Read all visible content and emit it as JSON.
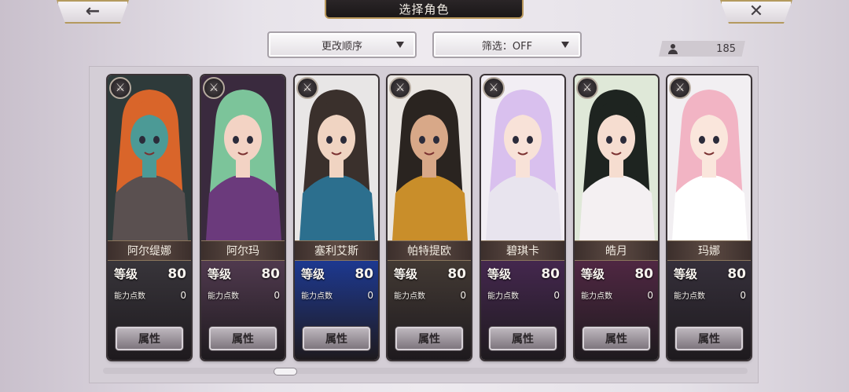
{
  "header": {
    "title": "选择角色",
    "back_glyph": "arrow-left-icon",
    "close_glyph": "close-icon"
  },
  "controls": {
    "sort_label": "更改顺序",
    "filter_label": "筛选：OFF",
    "character_count": "185"
  },
  "labels": {
    "level": "等级",
    "ability_points": "能力点数",
    "attributes_button": "属性"
  },
  "characters": [
    {
      "name": "阿尔缇娜",
      "level": "80",
      "ability_points": "0",
      "colors": {
        "bg": "#2e3a3a",
        "hair": "#d9652a",
        "skin": "#4c9a96",
        "outfit": "#5a5050",
        "lower": "#3d3a40"
      }
    },
    {
      "name": "阿尔玛",
      "level": "80",
      "ability_points": "0",
      "colors": {
        "bg": "#3a2a3e",
        "hair": "#7cc49a",
        "skin": "#f3d3c4",
        "outfit": "#6b3a7c",
        "lower": "#5a4058"
      }
    },
    {
      "name": "塞利艾斯",
      "level": "80",
      "ability_points": "0",
      "colors": {
        "bg": "#e8e6e6",
        "hair": "#3a302c",
        "skin": "#f0d4c2",
        "outfit": "#2c6f8e",
        "lower": "#1d3fa8"
      }
    },
    {
      "name": "帕特提欧",
      "level": "80",
      "ability_points": "0",
      "colors": {
        "bg": "#eae6e2",
        "hair": "#2a2420",
        "skin": "#d8a888",
        "outfit": "#c98e2a",
        "lower": "#4a4038"
      }
    },
    {
      "name": "碧琪卡",
      "level": "80",
      "ability_points": "0",
      "colors": {
        "bg": "#f2eef4",
        "hair": "#d9c0ee",
        "skin": "#f8e2d8",
        "outfit": "#e8e4ee",
        "lower": "#4c2a58"
      }
    },
    {
      "name": "皓月",
      "level": "80",
      "ability_points": "0",
      "colors": {
        "bg": "#dfe8d8",
        "hair": "#1e2420",
        "skin": "#f6ddd0",
        "outfit": "#f4f0f2",
        "lower": "#5a2a4a"
      }
    },
    {
      "name": "玛娜",
      "level": "80",
      "ability_points": "0",
      "colors": {
        "bg": "#f2eff2",
        "hair": "#f2b4c4",
        "skin": "#fae6dc",
        "outfit": "#ffffff",
        "lower": "#3a3440"
      }
    }
  ]
}
